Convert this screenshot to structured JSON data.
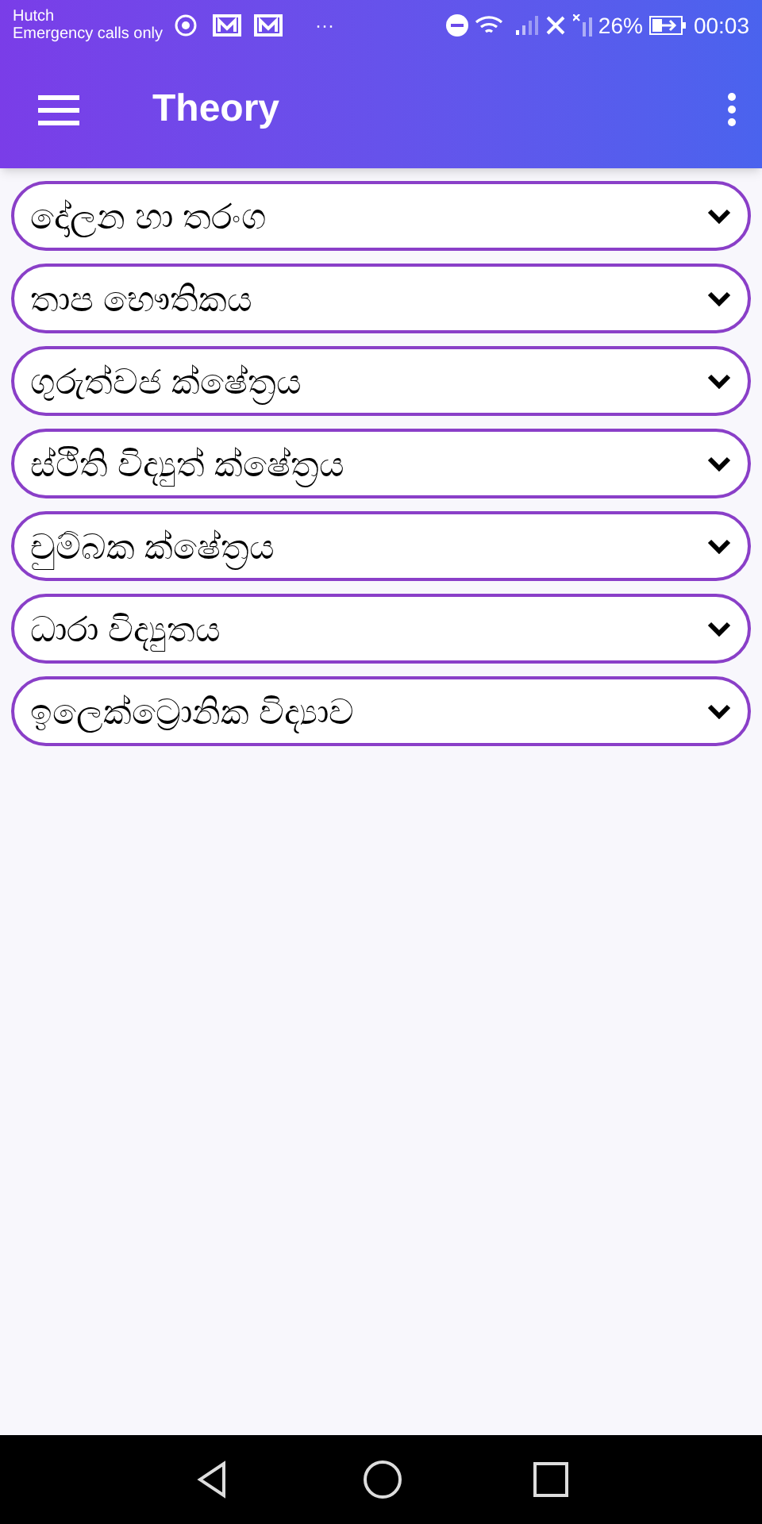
{
  "status_bar": {
    "carrier": "Hutch",
    "network_note": "Emergency calls only",
    "more": "···",
    "battery": "26%",
    "time": "00:03"
  },
  "app_bar": {
    "title": "Theory"
  },
  "items": [
    {
      "label": "දෝලන හා තරංග",
      "expanded": false
    },
    {
      "label": "තාප භෞතිකය",
      "expanded": false
    },
    {
      "label": "ගුරුත්වජ ක්ෂේත්‍රය",
      "expanded": false
    },
    {
      "label": "ස්ථිති විද්‍යුත් ක්ෂේත්‍රය",
      "expanded": false
    },
    {
      "label": "චුම්බක ක්ෂේත්‍රය",
      "expanded": false
    },
    {
      "label": "ධාරා විද්‍යුතය",
      "expanded": false
    },
    {
      "label": "ඉලෙක්ට්‍රොනික විද්‍යාව",
      "expanded": false
    }
  ]
}
